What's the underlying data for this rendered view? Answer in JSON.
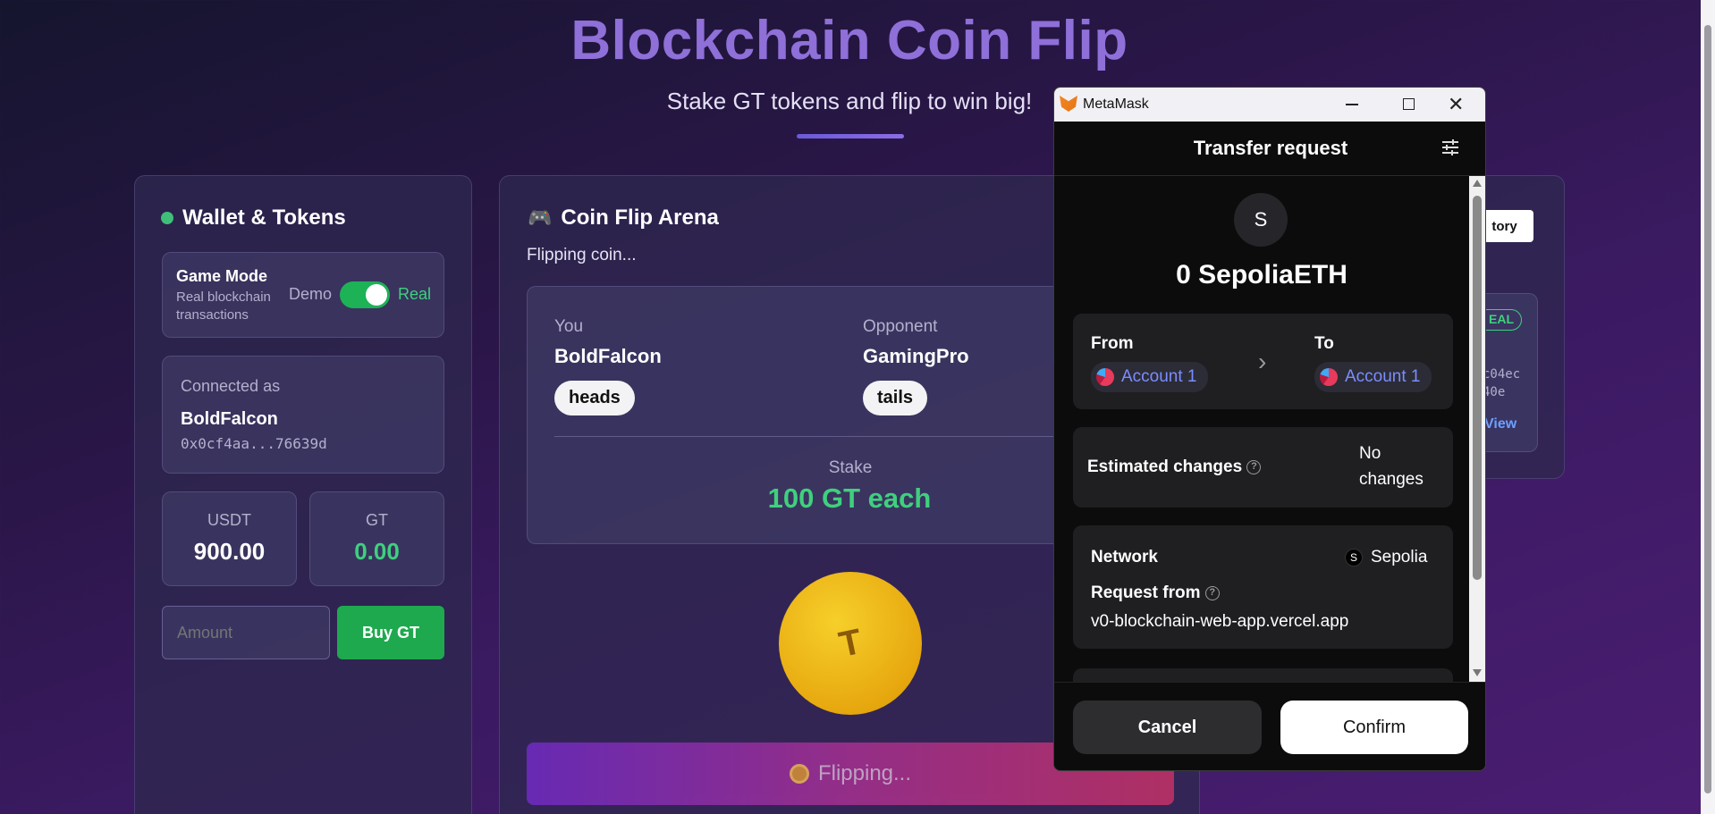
{
  "page": {
    "title": "Blockchain Coin Flip",
    "subtitle": "Stake GT tokens and flip to win big!"
  },
  "wallet": {
    "heading": "Wallet & Tokens",
    "game_mode_label": "Game Mode",
    "game_mode_desc_line1": "Real blockchain",
    "game_mode_desc_line2": "transactions",
    "toggle_left": "Demo",
    "toggle_right": "Real",
    "toggle_on": true,
    "connected_label": "Connected as",
    "username": "BoldFalcon",
    "address": "0x0cf4aa...76639d",
    "usdt_label": "USDT",
    "usdt_value": "900.00",
    "gt_label": "GT",
    "gt_value": "0.00",
    "amount_placeholder": "Amount",
    "buy_button": "Buy GT"
  },
  "arena": {
    "icon": "gamepad-icon",
    "heading": "Coin Flip Arena",
    "status": "Flipping coin...",
    "you_label": "You",
    "you_name": "BoldFalcon",
    "you_choice": "heads",
    "opponent_label": "Opponent",
    "opponent_name": "GamingPro",
    "opponent_choice": "tails",
    "stake_label": "Stake",
    "stake_value": "100 GT each",
    "coin_letter": "T",
    "flip_button": "Flipping..."
  },
  "history": {
    "button_fragment": "tory",
    "badge_fragment": "EAL",
    "hash_line1": "c04ec",
    "hash_line2": "40e",
    "view_link": "View"
  },
  "metamask": {
    "window_title": "MetaMask",
    "header": "Transfer request",
    "token_avatar": "S",
    "amount": "0 SepoliaETH",
    "from_label": "From",
    "from_account": "Account 1",
    "to_label": "To",
    "to_account": "Account 1",
    "estimated_label": "Estimated changes",
    "estimated_value_line1": "No",
    "estimated_value_line2": "changes",
    "network_label": "Network",
    "network_avatar": "S",
    "network_value": "Sepolia",
    "request_from_label": "Request from",
    "request_from_value": "v0-blockchain-web-app.vercel.app",
    "cancel_button": "Cancel",
    "confirm_button": "Confirm"
  }
}
